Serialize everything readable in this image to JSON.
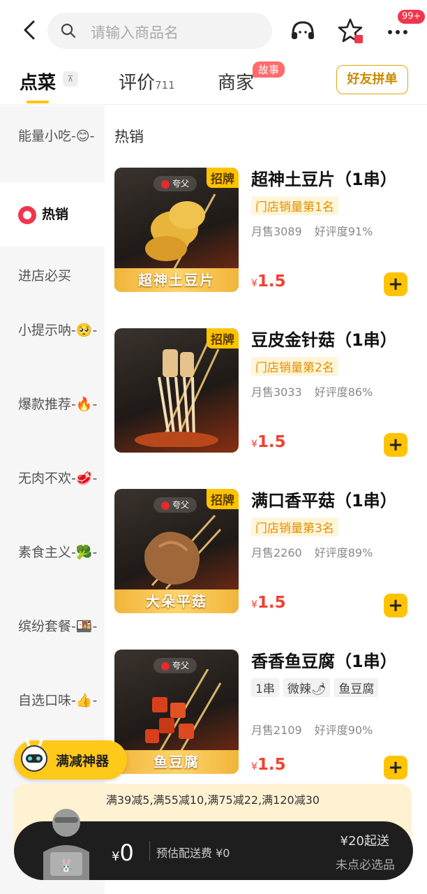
{
  "header": {
    "search_placeholder": "请输入商品名",
    "more_badge": "99+"
  },
  "tabs": {
    "order": "点菜",
    "reviews": "评价",
    "reviews_count": "711",
    "merchant": "商家",
    "story_badge": "故事",
    "friend_button": "好友拼单"
  },
  "sidebar": {
    "categories": [
      {
        "label": "能量小吃-😊-"
      },
      {
        "label": "热销"
      },
      {
        "label": "进店必买"
      },
      {
        "label": "小提示呐-🥺-"
      },
      {
        "label": "爆款推荐-🔥-"
      },
      {
        "label": "无肉不欢-🥩-"
      },
      {
        "label": "素食主义-🥦-"
      },
      {
        "label": "缤纷套餐-🍱-"
      },
      {
        "label": "自选口味-👍-"
      }
    ]
  },
  "section_title": "热销",
  "items": [
    {
      "name": "超神土豆片（1串）",
      "rank": "门店销量第1名",
      "monthly": "月售3089",
      "rating": "好评度91%",
      "price": "1.5",
      "badge": "招牌",
      "strip": "超神土豆片",
      "logo": "夸父"
    },
    {
      "name": "豆皮金针菇（1串）",
      "rank": "门店销量第2名",
      "monthly": "月售3033",
      "rating": "好评度86%",
      "price": "1.5",
      "badge": "招牌",
      "strip": "",
      "logo": ""
    },
    {
      "name": "满口香平菇（1串）",
      "rank": "门店销量第3名",
      "monthly": "月售2260",
      "rating": "好评度89%",
      "price": "1.5",
      "badge": "招牌",
      "strip": "大朵平菇",
      "logo": "夸父"
    },
    {
      "name": "香香鱼豆腐（1串）",
      "tags": [
        "1串",
        "微辣🌶",
        "鱼豆腐"
      ],
      "monthly": "月售2109",
      "rating": "好评度90%",
      "price": "1.5",
      "badge": "",
      "strip": "鱼豆腐",
      "logo": "夸父"
    }
  ],
  "promo": {
    "label": "满减神器",
    "discounts": "满39减5,满55减10,满75减22,满120减30"
  },
  "cart": {
    "currency": "¥",
    "total": "0",
    "delivery_fee": "预估配送费 ¥0",
    "min_order": "¥20起送",
    "note": "未点必选品"
  },
  "colors": {
    "accent": "#ffc300",
    "price": "#f24131",
    "cart_bg": "#1e1e1e"
  }
}
